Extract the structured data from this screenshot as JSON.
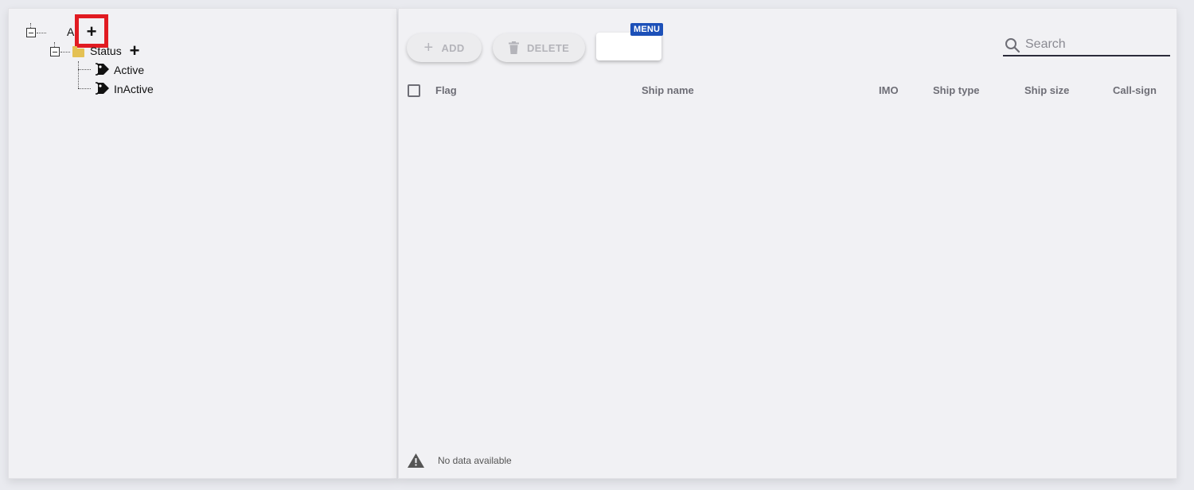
{
  "tree": {
    "root": {
      "label": "A",
      "expanded": true
    },
    "status": {
      "label": "Status",
      "expanded": true
    },
    "children": [
      {
        "label": "Active"
      },
      {
        "label": "InActive"
      }
    ],
    "add_symbol": "+"
  },
  "toolbar": {
    "add_label": "ADD",
    "delete_label": "DELETE",
    "menu_badge": "MENU",
    "add_symbol": "+"
  },
  "search": {
    "placeholder": "Search",
    "value": ""
  },
  "table": {
    "columns": [
      "Flag",
      "Ship name",
      "IMO",
      "Ship type",
      "Ship size",
      "Call-sign"
    ],
    "empty_message": "No data available"
  },
  "colors": {
    "highlight": "#e11b22",
    "badge": "#1c50b8",
    "folder": "#e4c154",
    "panel": "#f1f1f4"
  }
}
